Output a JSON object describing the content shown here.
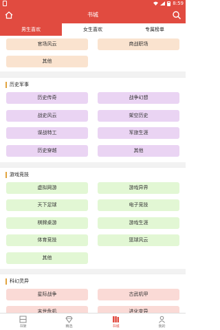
{
  "status": {
    "time": "8:59"
  },
  "app": {
    "title": "书城"
  },
  "tabs": [
    {
      "label": "男生喜欢",
      "active": true
    },
    {
      "label": "女生喜欢",
      "active": false
    },
    {
      "label": "专属榜单",
      "active": false
    }
  ],
  "partial_section": {
    "items": [
      "官场风云",
      "商战职场",
      "其他"
    ]
  },
  "sections": [
    {
      "title": "历史军事",
      "items": [
        "历史传奇",
        "战争幻想",
        "战史风云",
        "架空历史",
        "谍战特工",
        "军旅生涯",
        "历史穿越",
        "其他"
      ]
    },
    {
      "title": "游戏竞技",
      "items": [
        "虚拟网游",
        "游戏异界",
        "天下足球",
        "电子竞技",
        "棋牌桌游",
        "游戏生涯",
        "体育竞技",
        "篮球风云",
        "其他"
      ]
    },
    {
      "title": "科幻灵异",
      "items": [
        "星际战争",
        "古武机甲",
        "末世危机",
        "进化变异"
      ]
    }
  ],
  "bottom_nav": [
    {
      "label": "书架",
      "icon": "bookshelf-icon",
      "active": false
    },
    {
      "label": "精选",
      "icon": "diamond-icon",
      "active": false
    },
    {
      "label": "书城",
      "icon": "bookstore-icon",
      "active": true
    },
    {
      "label": "我的",
      "icon": "profile-icon",
      "active": false
    }
  ],
  "colors": {
    "brand": "#e14b40",
    "accent_bar": "#e0a23c",
    "peach": "#fae3cf",
    "purple": "#ead4f3",
    "green": "#e2f7d4",
    "pink": "#fadad6"
  }
}
